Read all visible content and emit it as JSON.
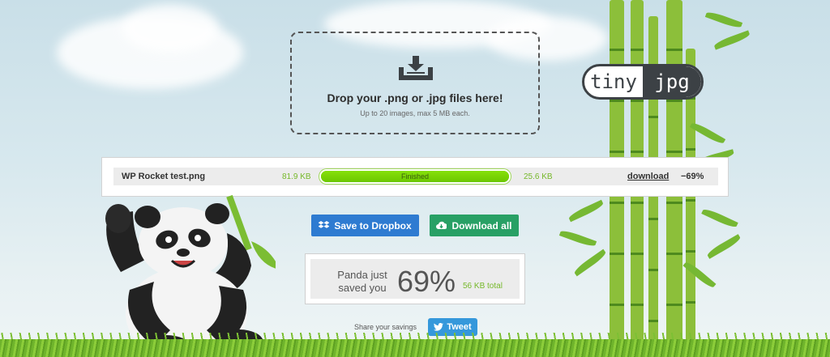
{
  "dropzone": {
    "title": "Drop your .png or .jpg files here!",
    "subtitle": "Up to 20 images, max 5 MB each.",
    "icon": "download-tray-icon"
  },
  "logo": {
    "left": "tiny",
    "right": "jpg"
  },
  "result": {
    "file_name": "WP Rocket test.png",
    "size_before": "81.9 KB",
    "status": "Finished",
    "progress": 1.0,
    "size_after": "25.6 KB",
    "download_label": "download",
    "savings": "−69%"
  },
  "actions": {
    "dropbox_label": "Save to Dropbox",
    "dropbox_icon": "dropbox-icon",
    "download_all_label": "Download all",
    "download_all_icon": "cloud-download-icon"
  },
  "summary": {
    "text": "Panda just saved you",
    "percent": "69%",
    "total": "56 KB total"
  },
  "share": {
    "label": "Share your savings",
    "tweet_label": "Tweet",
    "tweet_icon": "twitter-bird-icon"
  },
  "colors": {
    "accent_green": "#76b82a",
    "dropbox_blue": "#2e7bd1",
    "download_green": "#28a065",
    "twitter_blue": "#3598db"
  }
}
